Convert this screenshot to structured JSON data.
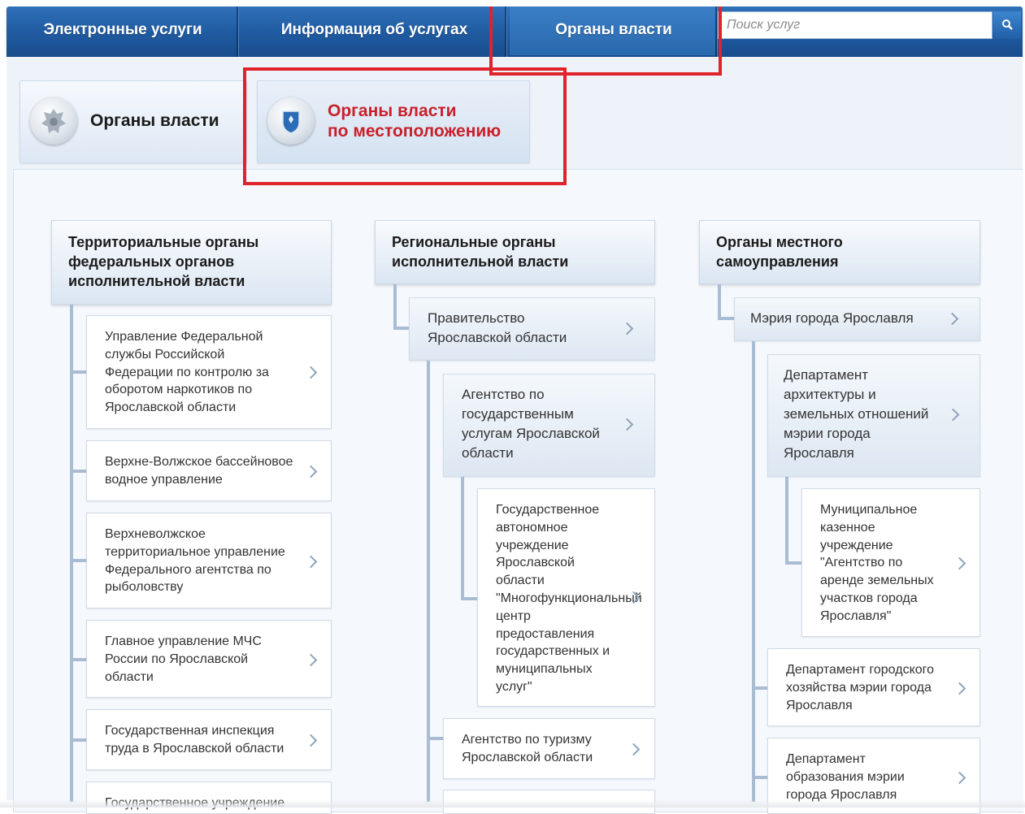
{
  "nav": {
    "tabs": [
      {
        "label": "Электронные услуги"
      },
      {
        "label": "Информация об услугах"
      },
      {
        "label": "Органы власти"
      }
    ],
    "search_placeholder": "Поиск услуг"
  },
  "subtabs": [
    {
      "line1": "Органы власти",
      "line2": ""
    },
    {
      "line1": "Органы власти",
      "line2": "по местоположению"
    }
  ],
  "colors": {
    "nav_blue": "#1f5aa0",
    "active_subtab_text": "#c8202a",
    "highlight_red": "#e0232b",
    "tree_line": "#a8bdd4"
  },
  "columns": [
    {
      "header": [
        "Территориальные органы",
        "федеральных органов",
        "исполнительной власти"
      ],
      "items": [
        {
          "lines": [
            "Управление Федеральной",
            "службы Российской",
            "Федерации по контролю за",
            "оборотом наркотиков по",
            "Ярославской области"
          ]
        },
        {
          "lines": [
            "Верхне-Волжское бассейновое",
            "водное управление"
          ]
        },
        {
          "lines": [
            "Верхневолжское",
            "территориальное управление",
            "Федерального агентства по",
            "рыболовству"
          ]
        },
        {
          "lines": [
            "Главное управление МЧС",
            "России по Ярославской",
            "области"
          ]
        },
        {
          "lines": [
            "Государственная инспекция",
            "труда в Ярославской области"
          ]
        },
        {
          "lines": [
            "Государственное учреждение"
          ]
        }
      ]
    },
    {
      "header": [
        "Региональные органы",
        "исполнительной власти"
      ],
      "items": [
        {
          "lines": [
            "Правительство",
            "Ярославской области"
          ]
        },
        {
          "lines": [
            "Агентство по",
            "государственным",
            "услугам Ярославской",
            "области"
          ]
        },
        {
          "lines": [
            "Государственное",
            "автономное",
            "учреждение",
            "Ярославской",
            "области",
            "\"Многофункциональный",
            "центр",
            "предоставления",
            "государственных и",
            "муниципальных",
            "услуг\""
          ]
        },
        {
          "lines": [
            "Агентство по туризму",
            "Ярославской области"
          ]
        }
      ]
    },
    {
      "header": [
        "Органы местного",
        "самоуправления"
      ],
      "items": [
        {
          "lines": [
            "Мэрия города Ярославля"
          ]
        },
        {
          "lines": [
            "Департамент",
            "архитектуры и",
            "земельных отношений",
            "мэрии города",
            "Ярославля"
          ]
        },
        {
          "lines": [
            "Муниципальное",
            "казенное",
            "учреждение",
            "\"Агентство по",
            "аренде земельных",
            "участков города",
            "Ярославля\""
          ]
        },
        {
          "lines": [
            "Департамент городского",
            "хозяйства мэрии города",
            "Ярославля"
          ]
        },
        {
          "lines": [
            "Департамент",
            "образования мэрии",
            "города Ярославля"
          ]
        }
      ]
    }
  ]
}
